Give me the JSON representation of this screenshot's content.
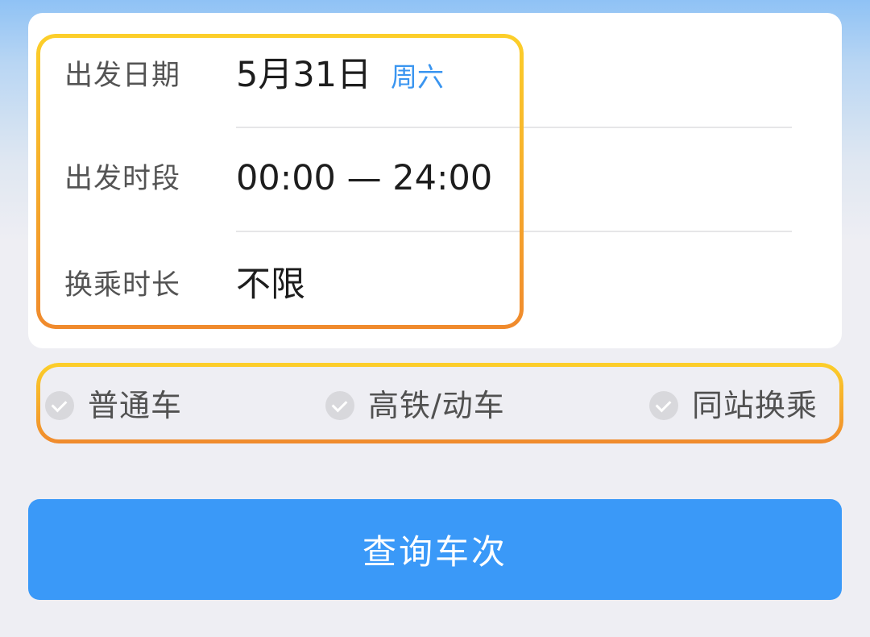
{
  "search_form": {
    "rows": [
      {
        "label": "出发日期",
        "value": "5月31日",
        "weekday": "周六"
      },
      {
        "label": "出发时段",
        "value": "00:00 — 24:00"
      },
      {
        "label": "换乘时长",
        "value": "不限"
      }
    ]
  },
  "filters": [
    {
      "label": "普通车",
      "checked": false
    },
    {
      "label": "高铁/动车",
      "checked": false
    },
    {
      "label": "同站换乘",
      "checked": false
    }
  ],
  "actions": {
    "query_label": "查询车次"
  },
  "colors": {
    "primary": "#3a99f8",
    "accent_text": "#3a95f0",
    "highlight_top": "#fccf2a",
    "highlight_bottom": "#f08a2d"
  }
}
